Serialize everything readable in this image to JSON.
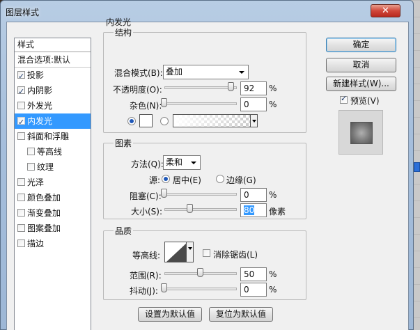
{
  "window": {
    "title": "图层样式",
    "close_symbol": "✕"
  },
  "styles_list": {
    "header": "样式",
    "blend_options": "混合选项:默认",
    "items": [
      {
        "label": "投影",
        "checked": true,
        "indent": false,
        "selected": false
      },
      {
        "label": "内阴影",
        "checked": true,
        "indent": false,
        "selected": false
      },
      {
        "label": "外发光",
        "checked": false,
        "indent": false,
        "selected": false
      },
      {
        "label": "内发光",
        "checked": true,
        "indent": false,
        "selected": true
      },
      {
        "label": "斜面和浮雕",
        "checked": false,
        "indent": false,
        "selected": false
      },
      {
        "label": "等高线",
        "checked": false,
        "indent": true,
        "selected": false
      },
      {
        "label": "纹理",
        "checked": false,
        "indent": true,
        "selected": false
      },
      {
        "label": "光泽",
        "checked": false,
        "indent": false,
        "selected": false
      },
      {
        "label": "颜色叠加",
        "checked": false,
        "indent": false,
        "selected": false
      },
      {
        "label": "渐变叠加",
        "checked": false,
        "indent": false,
        "selected": false
      },
      {
        "label": "图案叠加",
        "checked": false,
        "indent": false,
        "selected": false
      },
      {
        "label": "描边",
        "checked": false,
        "indent": false,
        "selected": false
      }
    ]
  },
  "panel": {
    "title": "内发光"
  },
  "structure": {
    "title": "结构",
    "blend_mode_label": "混合模式(B):",
    "blend_mode_value": "叠加",
    "opacity_label": "不透明度(O):",
    "opacity_value": "92",
    "opacity_level": 0.92,
    "noise_label": "杂色(N):",
    "noise_value": "0",
    "noise_level": 0,
    "percent": "%",
    "color_swatch": "#ffffff"
  },
  "elements": {
    "title": "图素",
    "method_label": "方法(Q):",
    "method_value": "柔和",
    "source_label": "源:",
    "source_center": "居中(E)",
    "source_edge": "边缘(G)",
    "choke_label": "阻塞(C):",
    "choke_value": "0",
    "choke_level": 0,
    "size_label": "大小(S):",
    "size_value": "80",
    "size_unit": "像素",
    "percent": "%"
  },
  "quality": {
    "title": "品质",
    "contour_label": "等高线:",
    "anti_alias_label": "消除锯齿(L)",
    "range_label": "范围(R):",
    "range_value": "50",
    "range_level": 0.5,
    "jitter_label": "抖动(J):",
    "jitter_value": "0",
    "jitter_level": 0,
    "percent": "%"
  },
  "buttons": {
    "make_default": "设置为默认值",
    "reset_default": "复位为默认值",
    "ok": "确定",
    "cancel": "取消",
    "new_style": "新建样式(W)...",
    "preview_label": "预览(V)",
    "preview_checked": true
  }
}
